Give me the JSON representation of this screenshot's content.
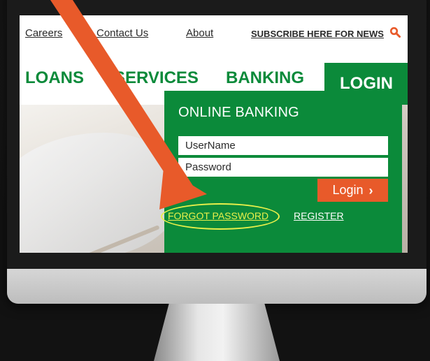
{
  "top_links": {
    "careers": "Careers",
    "contact": "Contact Us",
    "about": "About",
    "subscribe": "SUBSCRIBE HERE FOR NEWS"
  },
  "nav": {
    "loans": "LOANS",
    "services": "SERVICES",
    "banking": "BANKING",
    "login": "LOGIN"
  },
  "login": {
    "title": "ONLINE BANKING",
    "username_placeholder": "UserName",
    "password_placeholder": "Password",
    "button_label": "Login",
    "button_chevron": "›",
    "forgot": "FORGOT PASSWORD",
    "register": "REGISTER"
  },
  "colors": {
    "brand_green": "#0b8a3a",
    "accent_orange": "#e85a2a",
    "highlight_yellow": "#e9f04a"
  },
  "icons": {
    "search": "search-icon"
  }
}
